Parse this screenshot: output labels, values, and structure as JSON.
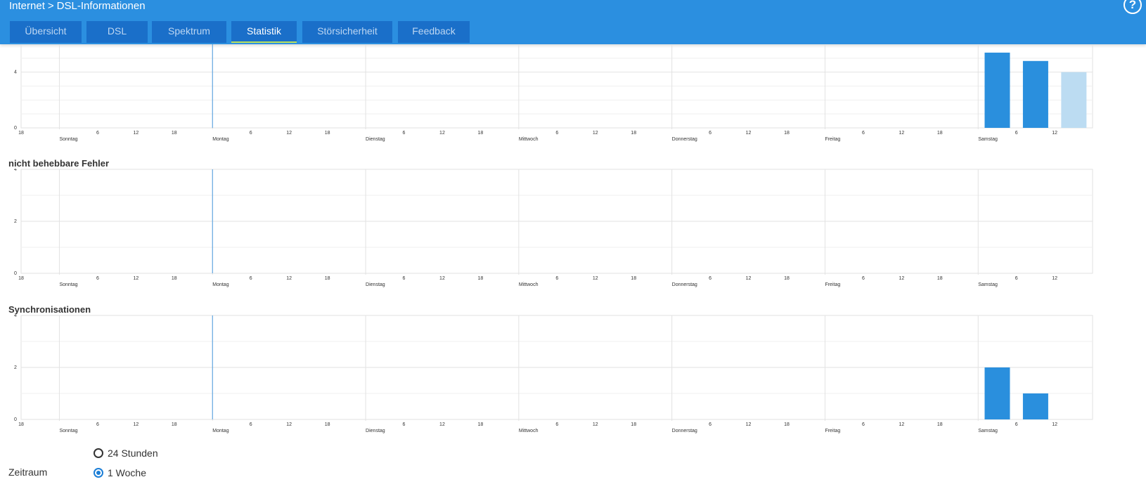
{
  "header": {
    "breadcrumb": [
      "Internet",
      "DSL-Informationen"
    ],
    "separator": ">",
    "help_symbol": "?",
    "tabs": [
      "Übersicht",
      "DSL",
      "Spektrum",
      "Statistik",
      "Störsicherheit",
      "Feedback"
    ],
    "active_tab": "Statistik"
  },
  "colors": {
    "header": "#2b8fe0",
    "tab": "#1a6fc9",
    "bar": "#2a8fdd",
    "bar_light": "#bcdcf2",
    "grid": "#e2e2e2",
    "marker": "#4a9be0"
  },
  "chart_data": [
    {
      "type": "bar",
      "title": "",
      "y_ticks": [
        "0",
        "4"
      ],
      "ylim": [
        0,
        6
      ],
      "x_tick_labels": [
        "18",
        "Sonntag",
        "6",
        "12",
        "18",
        "Montag",
        "6",
        "12",
        "18",
        "Dienstag",
        "6",
        "12",
        "18",
        "Mittwoch",
        "6",
        "12",
        "18",
        "Donnerstag",
        "6",
        "12",
        "18",
        "Freitag",
        "6",
        "12",
        "18",
        "Samstag",
        "6",
        "12"
      ],
      "series": [
        {
          "values": [
            {
              "day": "Samstag",
              "hour": 3,
              "value": 5.4
            },
            {
              "day": "Samstag",
              "hour": 9,
              "value": 4.8
            },
            {
              "day": "Samstag",
              "hour": 15,
              "value": 4.0,
              "current": true
            }
          ]
        }
      ]
    },
    {
      "type": "bar",
      "title": "nicht behebbare Fehler",
      "y_ticks": [
        "0",
        "2",
        "4"
      ],
      "ylim": [
        0,
        4
      ],
      "x_tick_labels": [
        "18",
        "Sonntag",
        "6",
        "12",
        "18",
        "Montag",
        "6",
        "12",
        "18",
        "Dienstag",
        "6",
        "12",
        "18",
        "Mittwoch",
        "6",
        "12",
        "18",
        "Donnerstag",
        "6",
        "12",
        "18",
        "Freitag",
        "6",
        "12",
        "18",
        "Samstag",
        "6",
        "12"
      ],
      "series": [
        {
          "values": []
        }
      ]
    },
    {
      "type": "bar",
      "title": "Synchronisationen",
      "y_ticks": [
        "0",
        "2",
        "4"
      ],
      "ylim": [
        0,
        4
      ],
      "x_tick_labels": [
        "18",
        "Sonntag",
        "6",
        "12",
        "18",
        "Montag",
        "6",
        "12",
        "18",
        "Dienstag",
        "6",
        "12",
        "18",
        "Mittwoch",
        "6",
        "12",
        "18",
        "Donnerstag",
        "6",
        "12",
        "18",
        "Freitag",
        "6",
        "12",
        "18",
        "Samstag",
        "6",
        "12"
      ],
      "series": [
        {
          "values": [
            {
              "day": "Samstag",
              "hour": 3,
              "value": 2
            },
            {
              "day": "Samstag",
              "hour": 9,
              "value": 1
            }
          ]
        }
      ]
    }
  ],
  "zeitraum": {
    "label": "Zeitraum",
    "options": [
      "24 Stunden",
      "1 Woche"
    ],
    "selected": "1 Woche"
  }
}
